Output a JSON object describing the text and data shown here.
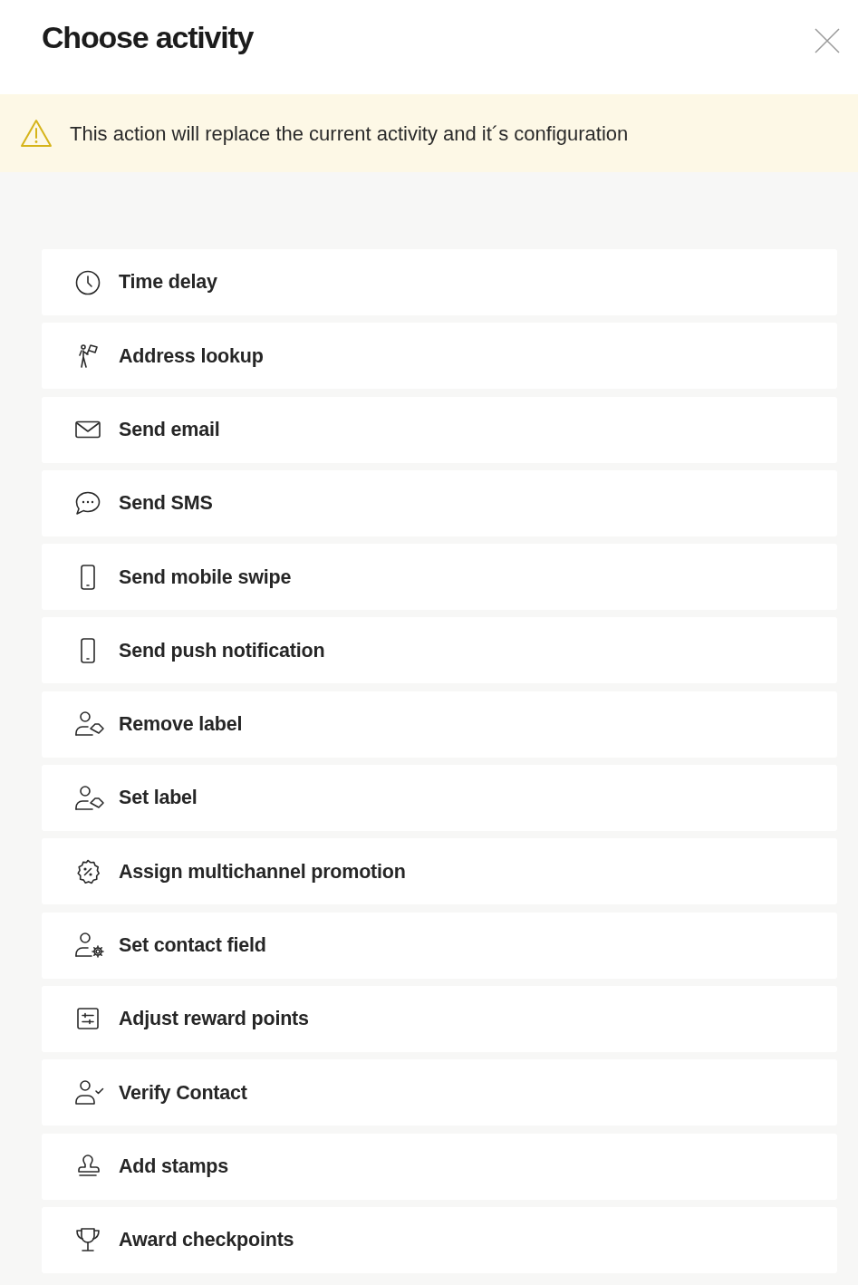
{
  "dialog": {
    "title": "Choose activity"
  },
  "warning": {
    "text": "This action will replace the current activity and it´s configuration"
  },
  "activities": [
    {
      "kind": "clock",
      "label": "Time delay"
    },
    {
      "kind": "hiker",
      "label": "Address lookup"
    },
    {
      "kind": "envelope",
      "label": "Send email"
    },
    {
      "kind": "chat",
      "label": "Send SMS"
    },
    {
      "kind": "phone",
      "label": "Send mobile swipe"
    },
    {
      "kind": "phone",
      "label": "Send push notification"
    },
    {
      "kind": "user-tag",
      "label": "Remove label"
    },
    {
      "kind": "user-tag",
      "label": "Set label"
    },
    {
      "kind": "percent-badge",
      "label": "Assign multichannel promotion"
    },
    {
      "kind": "user-gear",
      "label": "Set contact field"
    },
    {
      "kind": "sliders",
      "label": "Adjust reward points"
    },
    {
      "kind": "user-check",
      "label": "Verify Contact"
    },
    {
      "kind": "stamp",
      "label": "Add stamps"
    },
    {
      "kind": "trophy",
      "label": "Award checkpoints"
    }
  ]
}
